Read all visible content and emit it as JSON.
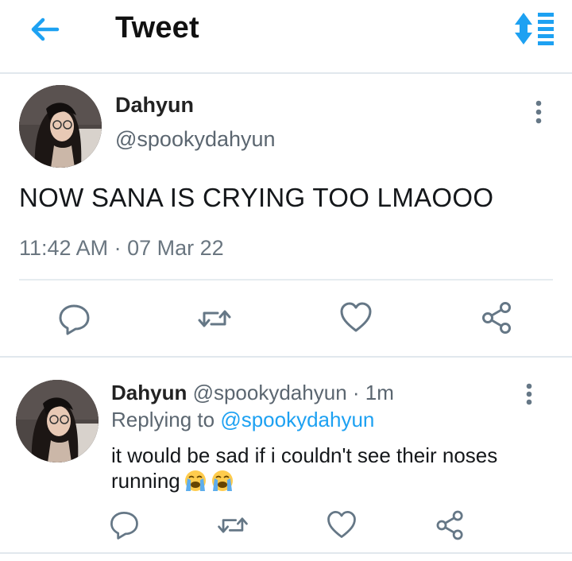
{
  "header": {
    "title": "Tweet",
    "back_icon": "arrow-left-icon",
    "sort_icon": "sort-list-icon",
    "accent": "#1da1f2"
  },
  "main_tweet": {
    "name": "Dahyun",
    "handle": "@spookydahyun",
    "text": "NOW SANA IS CRYING TOO LMAOOO",
    "timestamp": "11:42 AM · 07 Mar 22",
    "actions": [
      "reply-icon",
      "retweet-icon",
      "like-icon",
      "share-icon"
    ]
  },
  "reply_tweet": {
    "name": "Dahyun",
    "handle": "@spookydahyun",
    "age_separator": "·",
    "age": "1m",
    "replying_prefix": "Replying to",
    "replying_to": "@spookydahyun",
    "text": "it would be sad if i couldn't see their noses running",
    "emoji": [
      "loudly-crying-face",
      "loudly-crying-face"
    ],
    "actions": [
      "reply-icon",
      "retweet-icon",
      "like-icon",
      "share-icon"
    ]
  },
  "colors": {
    "accent": "#1da1f2",
    "text": "#14171a",
    "secondary": "#5b6670",
    "divider": "#e1e8ed"
  }
}
